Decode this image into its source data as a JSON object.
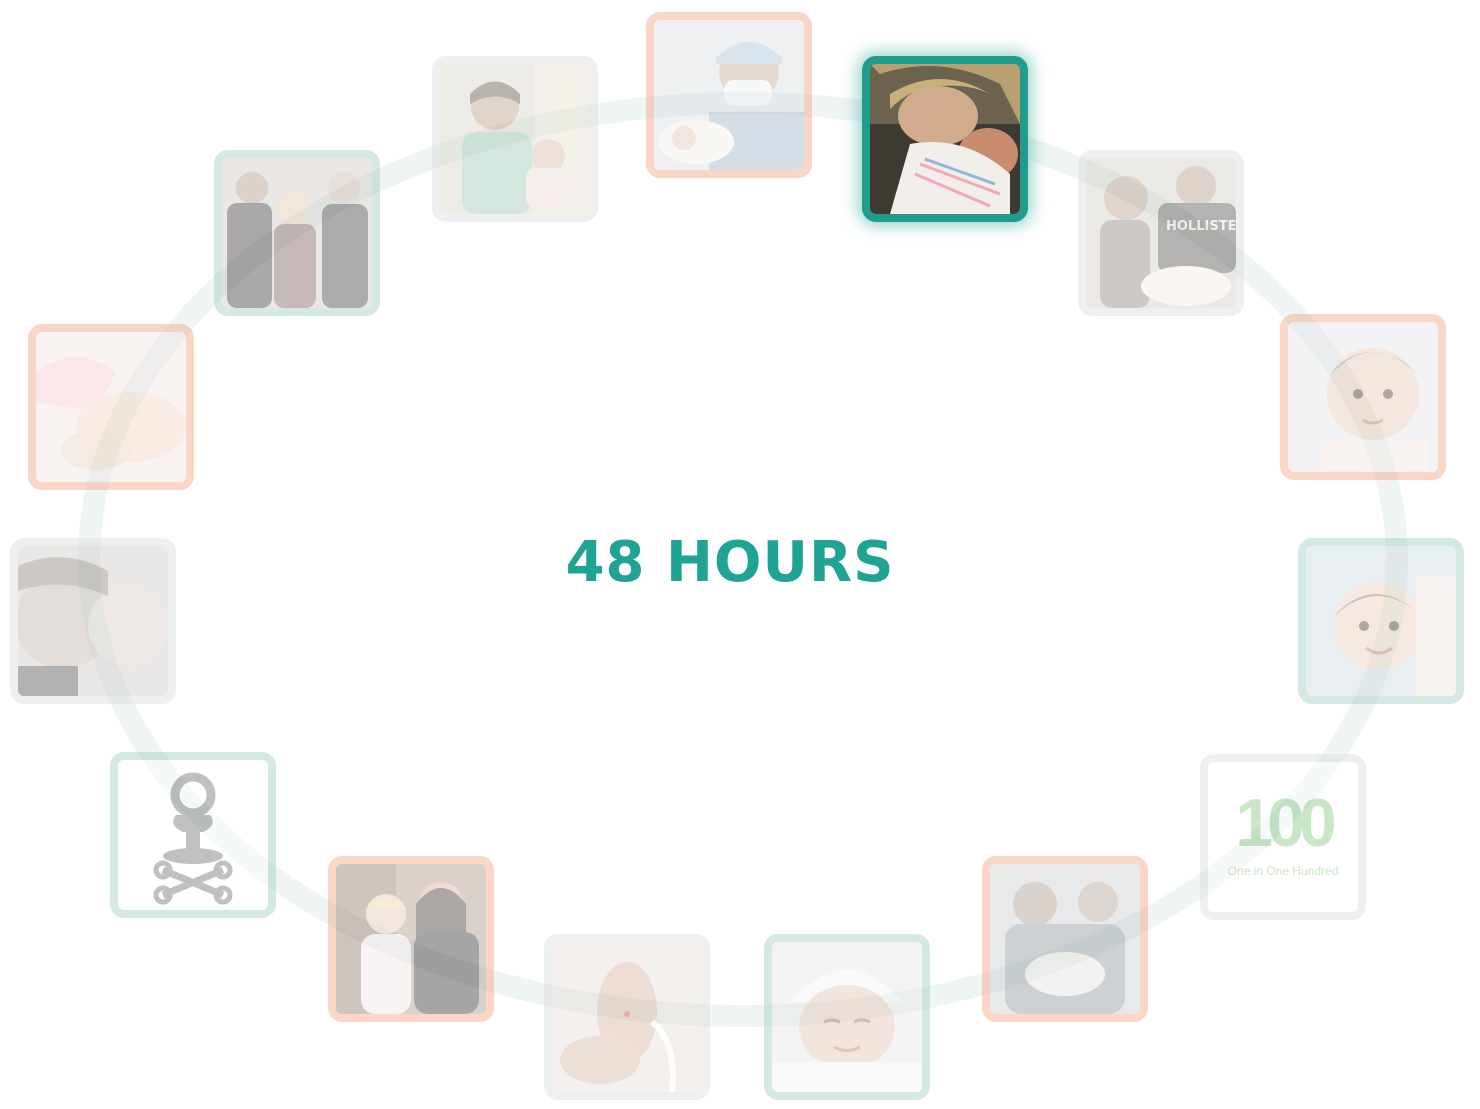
{
  "title": "48 HOURS",
  "logo": {
    "number": "100",
    "tagline": "One in One Hundred"
  },
  "colors": {
    "accent": "#1fa392",
    "peach_frame": "#f2a07a",
    "teal_frame": "#9ccbc1",
    "grey_frame": "#d9dbdb"
  },
  "tiles": [
    {
      "id": "doctor-newborn",
      "frame": "peach",
      "active": false
    },
    {
      "id": "mother-newborn",
      "frame": "teal",
      "active": true
    },
    {
      "id": "kids-newborn",
      "frame": "grey",
      "active": false
    },
    {
      "id": "baby-portrait",
      "frame": "peach",
      "active": false
    },
    {
      "id": "baby-smiling",
      "frame": "teal",
      "active": false
    },
    {
      "id": "one-in-one-hundred-logo",
      "frame": "grey",
      "active": false
    },
    {
      "id": "siblings-hospital",
      "frame": "peach",
      "active": false
    },
    {
      "id": "newborn-hat",
      "frame": "teal",
      "active": false
    },
    {
      "id": "baby-foot",
      "frame": "grey",
      "active": false
    },
    {
      "id": "mother-toddler",
      "frame": "peach",
      "active": false
    },
    {
      "id": "pacifier-pins-icon",
      "frame": "teal",
      "active": false
    },
    {
      "id": "sisters-cheek",
      "frame": "grey",
      "active": false
    },
    {
      "id": "baby-hands",
      "frame": "peach",
      "active": false
    },
    {
      "id": "group-visit",
      "frame": "teal",
      "active": false
    },
    {
      "id": "boy-holding-baby",
      "frame": "grey",
      "active": false
    }
  ]
}
